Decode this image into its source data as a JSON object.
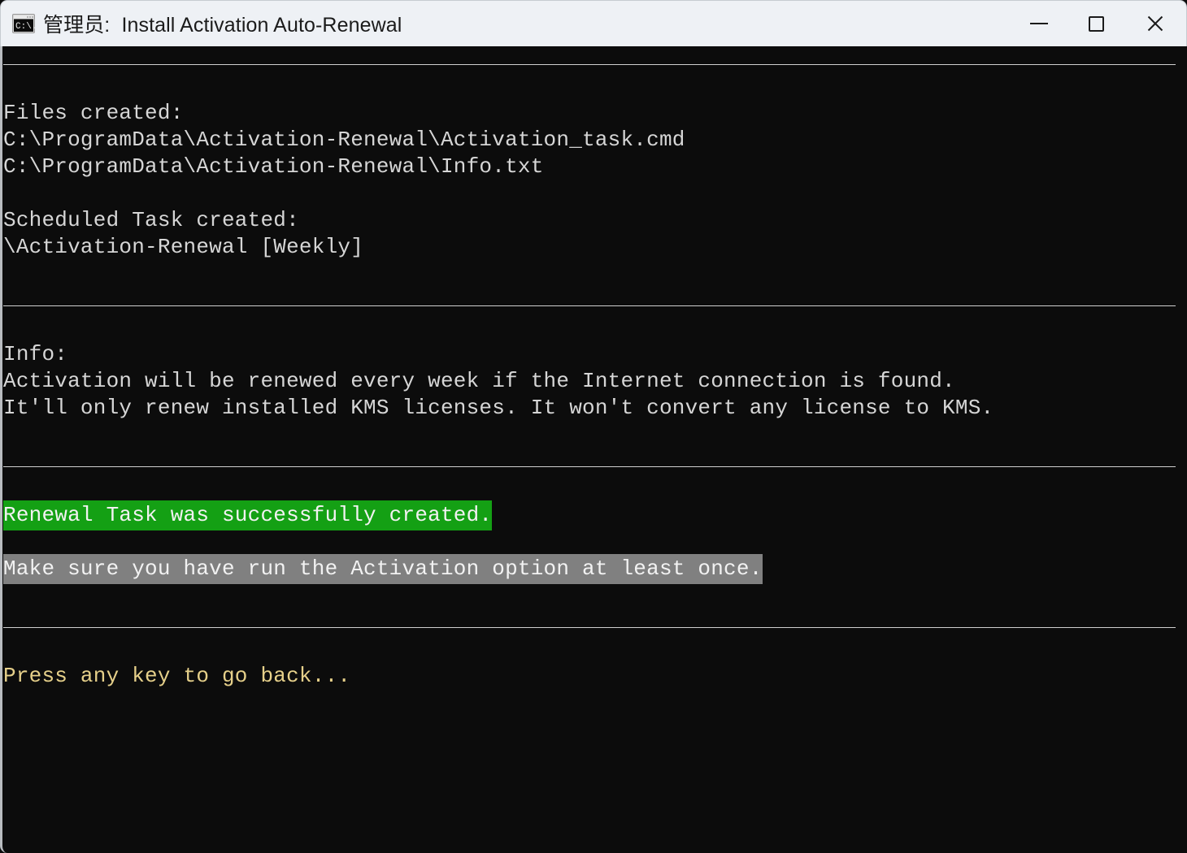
{
  "window": {
    "title_prefix": "管理员:",
    "title": "Install Activation Auto-Renewal",
    "full_title": "管理员:  Install Activation Auto-Renewal",
    "icon": "cmd-console-icon",
    "controls": {
      "minimize": "Minimize",
      "maximize": "Maximize",
      "close": "Close"
    },
    "titlebar_color": "#eef1f5",
    "background_color": "#0c0c0c"
  },
  "console": {
    "foreground_color": "#d4d4d4",
    "highlight_success_color": "#14a014",
    "highlight_note_color": "#808080",
    "prompt_color": "#e6d08a",
    "lines": [
      {
        "type": "rule"
      },
      {
        "type": "blank"
      },
      {
        "type": "text",
        "text": "Files created:"
      },
      {
        "type": "text",
        "text": "C:\\ProgramData\\Activation-Renewal\\Activation_task.cmd"
      },
      {
        "type": "text",
        "text": "C:\\ProgramData\\Activation-Renewal\\Info.txt"
      },
      {
        "type": "blank"
      },
      {
        "type": "text",
        "text": "Scheduled Task created:"
      },
      {
        "type": "text",
        "text": "\\Activation-Renewal [Weekly]"
      },
      {
        "type": "blank"
      },
      {
        "type": "rule"
      },
      {
        "type": "blank"
      },
      {
        "type": "text",
        "text": "Info:"
      },
      {
        "type": "text",
        "text": "Activation will be renewed every week if the Internet connection is found."
      },
      {
        "type": "text",
        "text": "It'll only renew installed KMS licenses. It won't convert any license to KMS."
      },
      {
        "type": "blank"
      },
      {
        "type": "rule"
      },
      {
        "type": "blank"
      },
      {
        "type": "highlight-green",
        "text": "Renewal Task was successfully created."
      },
      {
        "type": "blank"
      },
      {
        "type": "highlight-gray",
        "text": "Make sure you have run the Activation option at least once."
      },
      {
        "type": "blank"
      },
      {
        "type": "rule"
      },
      {
        "type": "blank"
      },
      {
        "type": "prompt",
        "text": "Press any key to go back..."
      }
    ]
  }
}
